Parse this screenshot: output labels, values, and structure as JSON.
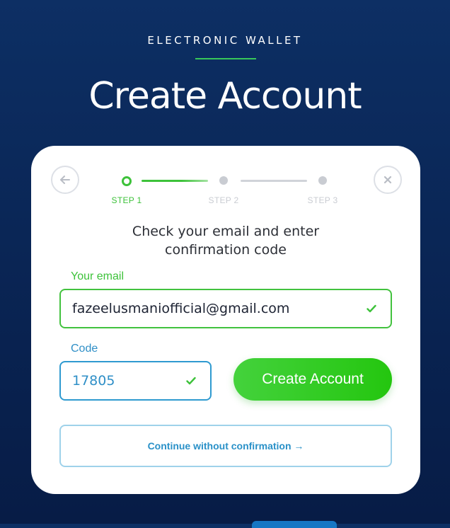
{
  "header": {
    "eyebrow": "ELECTRONIC WALLET",
    "title": "Create Account"
  },
  "stepper": {
    "steps": [
      {
        "label": "STEP 1",
        "active": true
      },
      {
        "label": "STEP 2",
        "active": false
      },
      {
        "label": "STEP 3",
        "active": false
      }
    ]
  },
  "card": {
    "instructions_line1": "Check your email and enter",
    "instructions_line2": "confirmation code",
    "email": {
      "label": "Your email",
      "value": "fazeelusmaniofficial@gmail.com"
    },
    "code": {
      "label": "Code",
      "value": "17805"
    },
    "create_button": "Create Account",
    "continue_button": "Continue without confirmation →"
  },
  "icons": {
    "back": "arrow-left-icon",
    "close": "close-icon",
    "check": "checkmark-icon"
  },
  "colors": {
    "accent_green": "#3dc23a",
    "accent_blue": "#2f8fc7",
    "background": "#0a2656"
  }
}
